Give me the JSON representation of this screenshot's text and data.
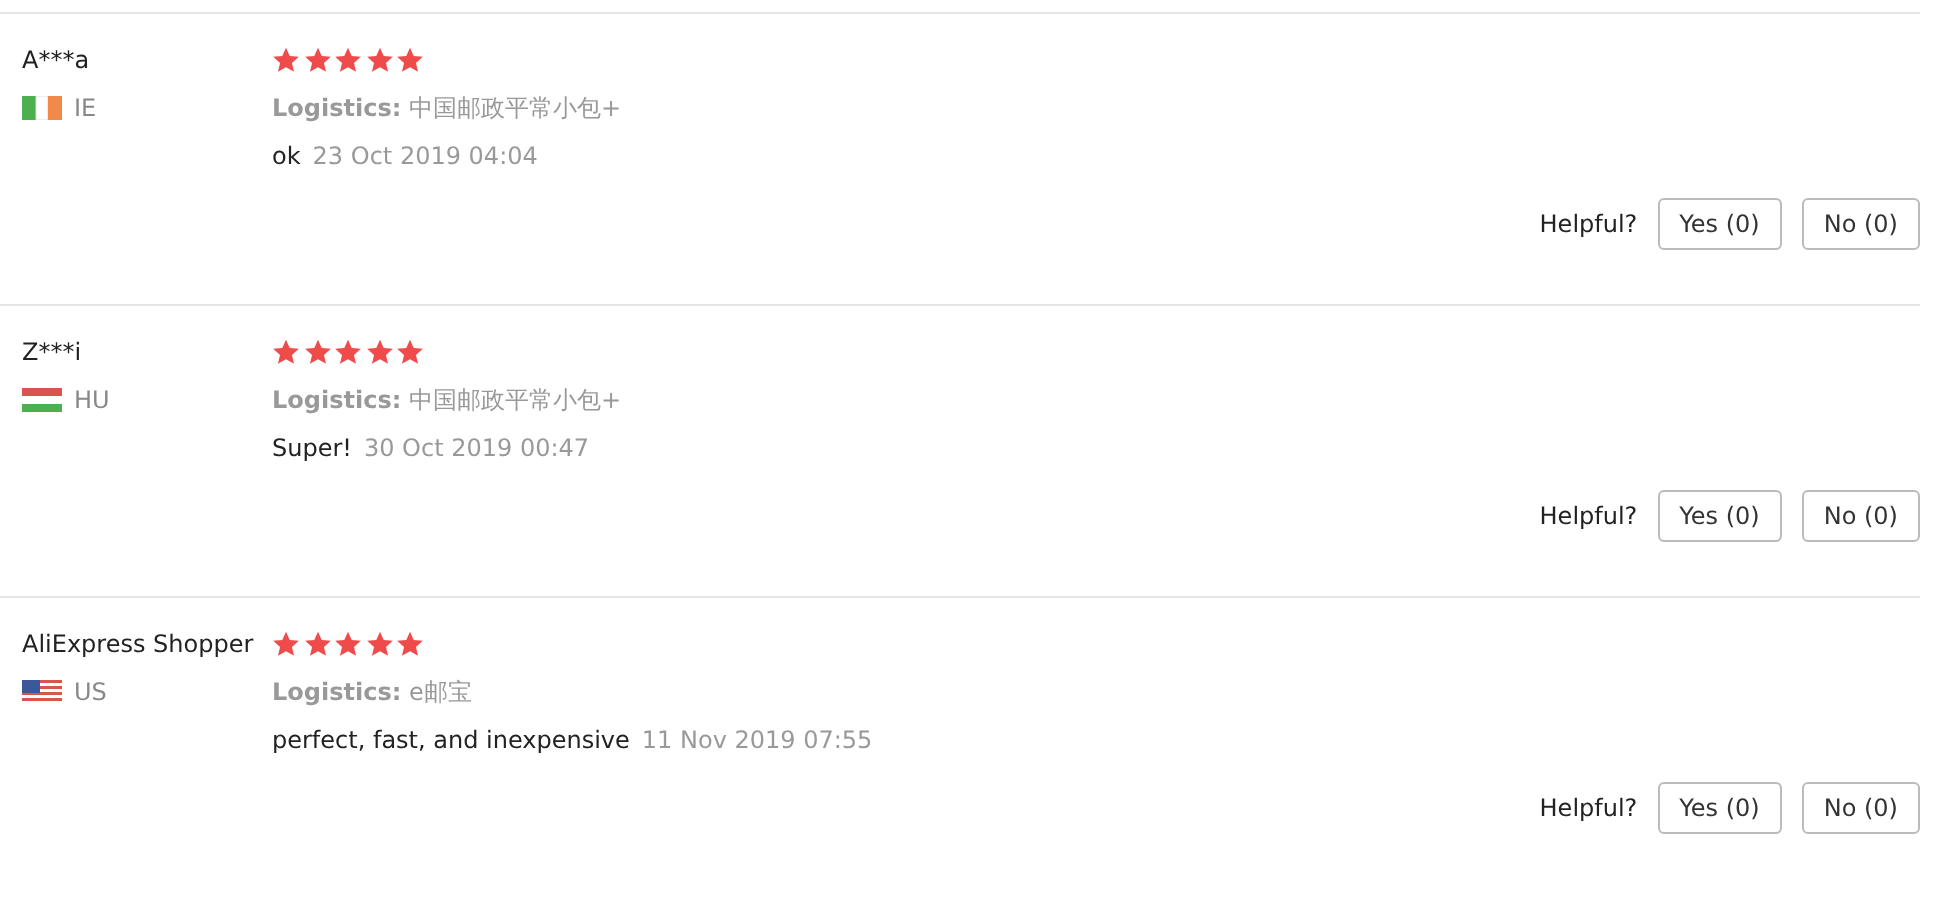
{
  "reviews": [
    {
      "name": "A***a",
      "country": "IE",
      "kind": "vertical-tricolor",
      "stars": 5,
      "logistics_label": "Logistics:",
      "logistics": "中国邮政平常小包+",
      "comment": "ok",
      "date": "23 Oct 2019 04:04",
      "helpful_label": "Helpful?",
      "yes": "Yes (0)",
      "no": "No (0)"
    },
    {
      "name": "Z***i",
      "country": "HU",
      "kind": "horizontal-tricolor",
      "stars": 5,
      "logistics_label": "Logistics:",
      "logistics": "中国邮政平常小包+",
      "comment": "Super!",
      "date": "30 Oct 2019 00:47",
      "helpful_label": "Helpful?",
      "yes": "Yes (0)",
      "no": "No (0)"
    },
    {
      "name": "AliExpress Shopper",
      "country": "US",
      "kind": "stripes-canton",
      "stars": 5,
      "logistics_label": "Logistics:",
      "logistics": "e邮宝",
      "comment": "perfect, fast, and inexpensive",
      "date": "11 Nov 2019 07:55",
      "helpful_label": "Helpful?",
      "yes": "Yes (0)",
      "no": "No (0)"
    }
  ]
}
